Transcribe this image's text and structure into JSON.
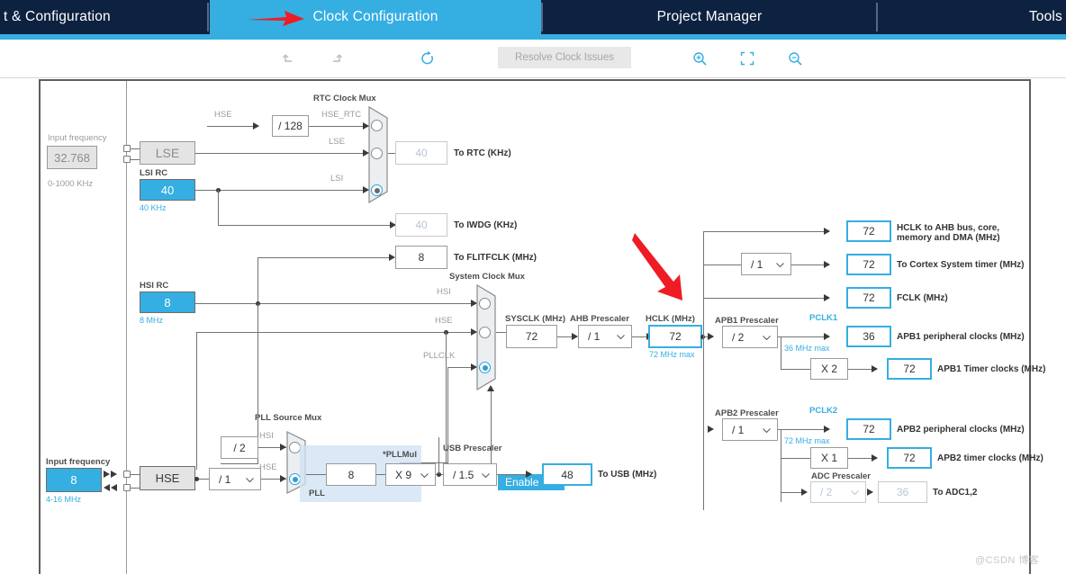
{
  "window": {
    "app": "STM32CubeMX Clock Configuration"
  },
  "tabs": [
    {
      "label": "t & Configuration",
      "active": false
    },
    {
      "label": "Clock Configuration",
      "active": true
    },
    {
      "label": "Project Manager",
      "active": false
    },
    {
      "label": "Tools",
      "active": false
    }
  ],
  "toolbar": {
    "undo_icon": "undo-icon",
    "redo_icon": "redo-icon",
    "reset_icon": "refresh-icon",
    "resolve_label": "Resolve Clock Issues",
    "zoom_in_icon": "zoom-in-icon",
    "fit_icon": "fit-to-screen-icon",
    "zoom_out_icon": "zoom-out-icon"
  },
  "diagram": {
    "lse": {
      "input_frequency_label": "Input frequency",
      "input_frequency_value": "32.768",
      "range": "0-1000 KHz",
      "osc_label": "LSE"
    },
    "lsi": {
      "title": "LSI RC",
      "value": "40",
      "unit": "40 KHz"
    },
    "hsi": {
      "title": "HSI RC",
      "value": "8",
      "unit": "8 MHz"
    },
    "hse": {
      "input_frequency_label": "Input frequency",
      "input_frequency_value": "8",
      "range": "4-16 MHz",
      "osc_label": "HSE"
    },
    "rtc_mux": {
      "title": "RTC Clock Mux",
      "inputs": [
        "HSE_RTC",
        "LSE",
        "LSI"
      ],
      "selected_index": 2
    },
    "hse_div128": {
      "label": "HSE",
      "value": "/ 128"
    },
    "outputs": {
      "to_rtc": {
        "value": "40",
        "label": "To RTC (KHz)"
      },
      "to_iwdg": {
        "value": "40",
        "label": "To IWDG (KHz)"
      },
      "to_flitfclk": {
        "value": "8",
        "label": "To FLITFCLK (MHz)"
      },
      "to_usb": {
        "value": "48",
        "label": "To USB (MHz)"
      },
      "to_adc": {
        "value": "36",
        "label": "To ADC1,2"
      },
      "hclk_ahb": {
        "value": "72",
        "label": "HCLK to AHB bus, core,",
        "label2": "memory and DMA (MHz)"
      },
      "cortex_timer": {
        "value": "72",
        "label": "To Cortex System timer (MHz)"
      },
      "fclk": {
        "value": "72",
        "label": "FCLK (MHz)"
      },
      "apb1_periph": {
        "value": "36",
        "label": "APB1 peripheral clocks (MHz)"
      },
      "apb1_timer": {
        "value": "72",
        "label": "APB1 Timer clocks (MHz)"
      },
      "apb2_periph": {
        "value": "72",
        "label": "APB2 peripheral clocks (MHz)"
      },
      "apb2_timer": {
        "value": "72",
        "label": "APB2 timer clocks (MHz)"
      }
    },
    "system_clock_mux": {
      "title": "System Clock Mux",
      "inputs": [
        "HSI",
        "HSE",
        "PLLCLK"
      ],
      "selected_index": 2
    },
    "enable_css": {
      "label": "Enable CSS"
    },
    "sysclk": {
      "title": "SYSCLK (MHz)",
      "value": "72"
    },
    "ahb_prescaler": {
      "title": "AHB Prescaler",
      "value": "/ 1"
    },
    "hclk": {
      "title": "HCLK (MHz)",
      "value": "72",
      "max": "72 MHz max"
    },
    "cortex_prescaler": {
      "value": "/ 1"
    },
    "apb1_prescaler": {
      "title": "APB1 Prescaler",
      "value": "/ 2",
      "pclk": "PCLK1",
      "max": "36 MHz max",
      "mult": "X 2"
    },
    "apb2_prescaler": {
      "title": "APB2 Prescaler",
      "value": "/ 1",
      "pclk": "PCLK2",
      "max": "72 MHz max",
      "mult": "X 1"
    },
    "adc_prescaler": {
      "title": "ADC Prescaler",
      "value": "/ 2"
    },
    "pll_source_mux": {
      "title": "PLL Source Mux",
      "inputs": [
        "HSI",
        "HSE"
      ],
      "selected_index": 1
    },
    "hsi_div2": {
      "value": "/ 2"
    },
    "hse_div": {
      "value": "/ 1"
    },
    "pll": {
      "label": "PLL",
      "input_value": "8",
      "mul_title": "*PLLMul",
      "mul_value": "X 9"
    },
    "usb_prescaler": {
      "title": "USB Prescaler",
      "value": "/ 1.5"
    }
  },
  "colors": {
    "tab_inactive": "#0d2240",
    "tab_active": "#35aee2",
    "accent": "#35aee2",
    "annotation_red": "#ee1c25"
  },
  "watermark": {
    "text": "@CSDN 博客"
  }
}
